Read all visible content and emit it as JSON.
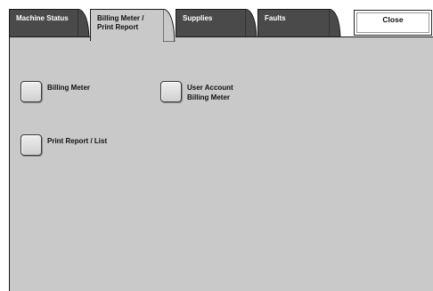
{
  "tabs": [
    {
      "line1": "Machine Status",
      "line2": ""
    },
    {
      "line1": "Billing Meter /",
      "line2": "Print Report"
    },
    {
      "line1": "Supplies",
      "line2": ""
    },
    {
      "line1": "Faults",
      "line2": ""
    }
  ],
  "active_tab": "Billing Meter / Print Report",
  "close_label": "Close",
  "options": {
    "billing_meter": {
      "line1": "Billing Meter",
      "line2": ""
    },
    "user_account_billing_meter": {
      "line1": "User Account",
      "line2": "Billing Meter"
    },
    "print_report_list": {
      "line1": "Print Report / List",
      "line2": ""
    }
  },
  "colors": {
    "tab_inactive": "#4a4a4a",
    "panel": "#c9c9c9",
    "background": "#ffffff"
  }
}
